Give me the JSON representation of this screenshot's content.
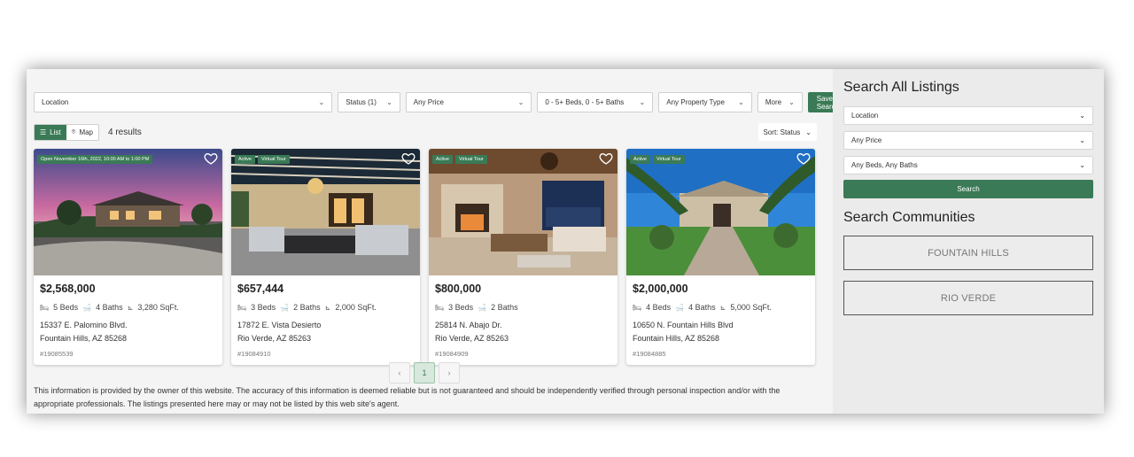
{
  "filters": {
    "location": "Location",
    "status": "Status (1)",
    "price": "Any Price",
    "beds": "0 - 5+ Beds, 0 - 5+ Baths",
    "type": "Any Property Type",
    "more": "More",
    "save": "Save Search"
  },
  "view": {
    "list_label": "List",
    "map_label": "Map",
    "results": "4 results",
    "sort": "Sort: Status"
  },
  "listings": [
    {
      "badges": [
        "Open November 16th, 2022, 10:00 AM to 1:00 PM"
      ],
      "price": "$2,568,000",
      "beds": "5 Beds",
      "baths": "4 Baths",
      "sqft": "3,280 SqFt.",
      "address1": "15337 E. Palomino Blvd.",
      "address2": "Fountain Hills, AZ 85268",
      "mls": "#19085539"
    },
    {
      "badges": [
        "Active",
        "Virtual Tour"
      ],
      "price": "$657,444",
      "beds": "3 Beds",
      "baths": "2 Baths",
      "sqft": "2,000 SqFt.",
      "address1": "17872 E. Vista Desierto",
      "address2": "Rio Verde, AZ 85263",
      "mls": "#19084910"
    },
    {
      "badges": [
        "Active",
        "Virtual Tour"
      ],
      "price": "$800,000",
      "beds": "3 Beds",
      "baths": "2 Baths",
      "sqft": "",
      "address1": "25814 N. Abajo Dr.",
      "address2": "Rio Verde, AZ 85263",
      "mls": "#19084909"
    },
    {
      "badges": [
        "Active",
        "Virtual Tour"
      ],
      "price": "$2,000,000",
      "beds": "4 Beds",
      "baths": "4 Baths",
      "sqft": "5,000 SqFt.",
      "address1": "10650 N. Fountain Hills Blvd",
      "address2": "Fountain Hills, AZ 85268",
      "mls": "#19084885"
    }
  ],
  "pagination": {
    "prev": "‹",
    "current": "1",
    "next": "›"
  },
  "disclaimer": "This information is provided by the owner of this website. The accuracy of this information is deemed reliable but is not guaranteed and should be independently verified through personal inspection and/or with the appropriate professionals. The listings presented here may or may not be listed by this web site's agent.",
  "sidebar": {
    "search_title": "Search All Listings",
    "location": "Location",
    "price": "Any Price",
    "beds": "Any Beds, Any Baths",
    "search_button": "Search",
    "communities_title": "Search Communities",
    "communities": [
      "FOUNTAIN HILLS",
      "RIO VERDE"
    ]
  },
  "colors": {
    "accent": "#3a7a56"
  }
}
